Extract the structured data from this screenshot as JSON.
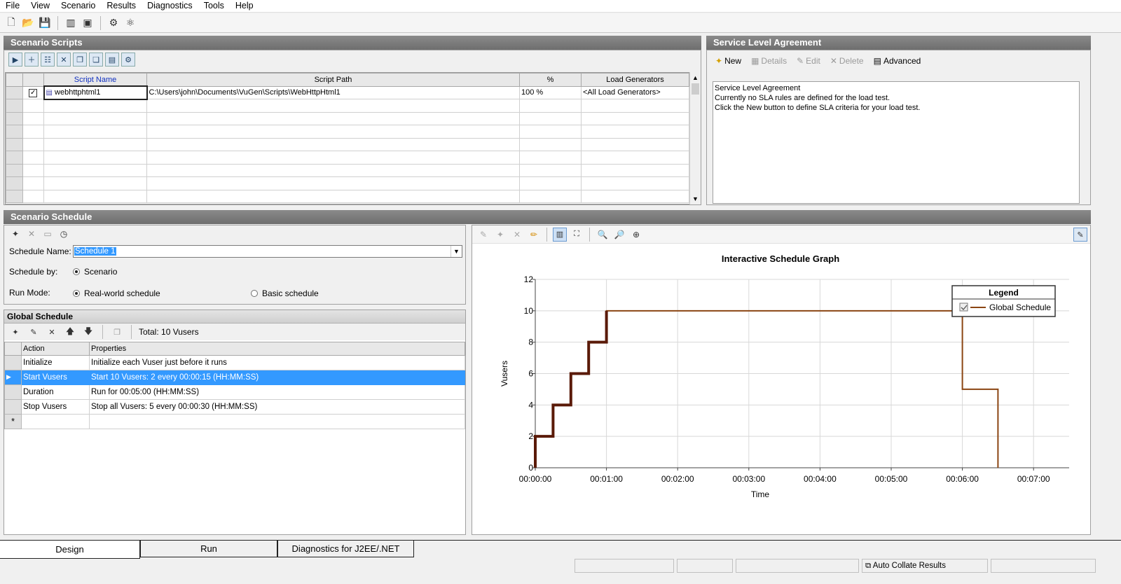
{
  "menu": [
    "File",
    "View",
    "Scenario",
    "Results",
    "Diagnostics",
    "Tools",
    "Help"
  ],
  "scripts_panel": {
    "title": "Scenario Scripts",
    "columns": [
      "",
      "",
      "Script Name",
      "Script Path",
      "%",
      "Load Generators"
    ],
    "rows": [
      {
        "checked": true,
        "name": "webhttphtml1",
        "path": "C:\\Users\\john\\Documents\\VuGen\\Scripts\\WebHttpHtml1",
        "percent": "100 %",
        "load_generators": "<All Load Generators>"
      }
    ]
  },
  "sla_panel": {
    "title": "Service Level Agreement",
    "toolbar": {
      "new": "New",
      "details": "Details",
      "edit": "Edit",
      "delete": "Delete",
      "advanced": "Advanced"
    },
    "heading": "Service Level Agreement",
    "line1": "Currently no SLA rules are defined for the load test.",
    "line2": "Click the New button to define SLA criteria for your load test."
  },
  "schedule_panel": {
    "title": "Scenario Schedule",
    "schedule_name_label": "Schedule Name:",
    "schedule_name_value": "Schedule 1",
    "schedule_by_label": "Schedule by:",
    "schedule_by_value": "Scenario",
    "run_mode_label": "Run Mode:",
    "run_mode_option1": "Real-world schedule",
    "run_mode_option2": "Basic schedule",
    "global_schedule_title": "Global Schedule",
    "total_label": "Total: 10 Vusers",
    "columns": [
      "Action",
      "Properties"
    ],
    "actions": [
      {
        "action": "Initialize",
        "properties": "Initialize each Vuser just before it runs",
        "selected": false
      },
      {
        "action": "Start  Vusers",
        "properties": "Start 10 Vusers: 2 every 00:00:15 (HH:MM:SS)",
        "selected": true
      },
      {
        "action": "Duration",
        "properties": "Run for 00:05:00 (HH:MM:SS)",
        "selected": false
      },
      {
        "action": "Stop Vusers",
        "properties": "Stop all Vusers: 5 every 00:00:30 (HH:MM:SS)",
        "selected": false
      }
    ],
    "new_row_marker": "*"
  },
  "chart_data": {
    "type": "line",
    "title": "Interactive Schedule Graph",
    "xlabel": "Time",
    "ylabel": "Vusers",
    "xlim_seconds": [
      0,
      450
    ],
    "ylim": [
      0,
      12
    ],
    "x_ticks": [
      "00:00:00",
      "00:01:00",
      "00:02:00",
      "00:03:00",
      "00:04:00",
      "00:05:00",
      "00:06:00",
      "00:07:00"
    ],
    "y_ticks": [
      0,
      2,
      4,
      6,
      8,
      10,
      12
    ],
    "legend_title": "Legend",
    "legend_placement": "top-right",
    "series": [
      {
        "name": "Global Schedule",
        "color": "#8b4513",
        "highlight_color": "#5a1a08",
        "points_seconds": [
          [
            0,
            0
          ],
          [
            0,
            2
          ],
          [
            15,
            2
          ],
          [
            15,
            4
          ],
          [
            30,
            4
          ],
          [
            30,
            6
          ],
          [
            45,
            6
          ],
          [
            45,
            8
          ],
          [
            60,
            8
          ],
          [
            60,
            10
          ],
          [
            360,
            10
          ],
          [
            360,
            5
          ],
          [
            390,
            5
          ],
          [
            390,
            0
          ]
        ],
        "highlight_until_seconds": 60
      }
    ],
    "grid": true
  },
  "tabs": [
    "Design",
    "Run",
    "Diagnostics for J2EE/.NET"
  ],
  "status": {
    "auto_collate": "Auto Collate Results"
  }
}
